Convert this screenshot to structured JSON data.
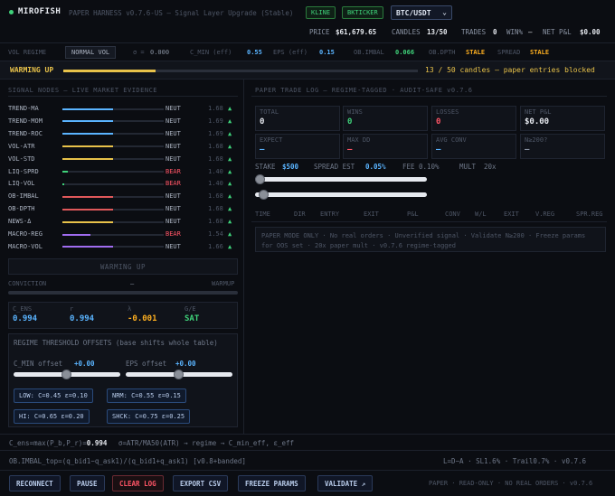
{
  "header": {
    "brand": "MIROFISH",
    "subtitle": "PAPER HARNESS v0.7.6-US — Signal Layer Upgrade (Stable)",
    "badge_kline": "KLINE",
    "badge_bkticker": "BKTICKER",
    "symbol": "BTC/USDT",
    "price_label": "PRICE",
    "price_value": "$61,679.65",
    "candles_label": "CANDLES",
    "candles_value": "13/50",
    "trades_label": "TRADES",
    "trades_value": "0",
    "wins_label": "WIN%",
    "wins_value": "—",
    "netpnl_label": "NET P&L",
    "netpnl_value": "$0.00"
  },
  "strip": {
    "vol_regime_label": "VOL REGIME",
    "vol_regime_value": "NORMAL VOL",
    "sigma_label": "σ =",
    "sigma_value": "0.000",
    "cmin_label": "C_MIN (eff)",
    "cmin_value": "0.55",
    "eps_label": "EPS (eff)",
    "eps_value": "0.15",
    "obimbal_label": "OB.IMBAL",
    "obimbal_value": "0.066",
    "obdpth_label": "OB.DPTH",
    "obdpth_value": "STALE",
    "spread_label": "SPREAD",
    "spread_value": "STALE"
  },
  "warming": {
    "label": "WARMING UP",
    "progress": 0.26,
    "status": "13 / 50 candles — paper entries blocked"
  },
  "signal_panel": {
    "title": "SIGNAL NODES — LIVE MARKET EVIDENCE",
    "nodes": [
      {
        "name": "TREND-MA",
        "fill": 0.5,
        "color": "#5ab4ff",
        "state": "NEUT",
        "value": "1.68"
      },
      {
        "name": "TREND-MOM",
        "fill": 0.5,
        "color": "#5ab4ff",
        "state": "NEUT",
        "value": "1.69"
      },
      {
        "name": "TREND-ROC",
        "fill": 0.5,
        "color": "#5ab4ff",
        "state": "NEUT",
        "value": "1.69"
      },
      {
        "name": "VOL-ATR",
        "fill": 0.5,
        "color": "#e8c24a",
        "state": "NEUT",
        "value": "1.68"
      },
      {
        "name": "VOL-STD",
        "fill": 0.5,
        "color": "#e8c24a",
        "state": "NEUT",
        "value": "1.68"
      },
      {
        "name": "LIQ-SPRD",
        "fill": 0.05,
        "color": "#3fd27a",
        "state": "BEAR",
        "value": "1.40"
      },
      {
        "name": "LIQ-VOL",
        "fill": 0.02,
        "color": "#3fd27a",
        "state": "BEAR",
        "value": "1.40"
      },
      {
        "name": "OB-IMBAL",
        "fill": 0.5,
        "color": "#e0585a",
        "state": "NEUT",
        "value": "1.68"
      },
      {
        "name": "OB-DPTH",
        "fill": 0.5,
        "color": "#e0585a",
        "state": "NEUT",
        "value": "1.68"
      },
      {
        "name": "NEWS-Δ",
        "fill": 0.5,
        "color": "#e8c24a",
        "state": "NEUT",
        "value": "1.68"
      },
      {
        "name": "MACRO-REG",
        "fill": 0.28,
        "color": "#a06cf0",
        "state": "BEAR",
        "value": "1.54"
      },
      {
        "name": "MACRO-VOL",
        "fill": 0.5,
        "color": "#a06cf0",
        "state": "NEUT",
        "value": "1.66"
      }
    ],
    "arrow": "▲",
    "warming_box": "WARMING UP",
    "conviction_label": "CONVICTION",
    "conviction_value": "—",
    "conviction_state": "WARMUP",
    "c_ens_label": "C_ENS",
    "c_ens_value": "0.994",
    "r_label": "r",
    "r_value": "0.994",
    "lambda_label": "λ",
    "lambda_value": "-0.001",
    "gate_label": "G/E",
    "gate_value": "SAT",
    "regime_title": "REGIME THRESHOLD OFFSETS (base shifts whole table)",
    "cmin_offset_label": "C_MIN offset",
    "cmin_offset_value": "+0.00",
    "eps_offset_label": "EPS offset",
    "eps_offset_value": "+0.00",
    "chips": [
      "LOW: C=0.45 ε=0.10",
      "NRM: C=0.55 ε=0.15",
      "HI: C=0.65 ε=0.20",
      "SHCK: C=0.75 ε=0.25"
    ]
  },
  "trade_panel": {
    "title": "PAPER TRADE LOG — REGIME-TAGGED · AUDIT-SAFE v0.7.6",
    "stats_row1": [
      {
        "label": "TOTAL",
        "value": "0",
        "color": "#e6e9ef"
      },
      {
        "label": "WINS",
        "value": "0",
        "color": "#3fd27a"
      },
      {
        "label": "LOSSES",
        "value": "0",
        "color": "#ff5566"
      },
      {
        "label": "NET P&L",
        "value": "$0.00",
        "color": "#e6e9ef"
      }
    ],
    "stats_row2": [
      {
        "label": "EXPECT",
        "value": "—",
        "color": "#5ab4ff"
      },
      {
        "label": "MAX DD",
        "value": "—",
        "color": "#ff5566"
      },
      {
        "label": "AVG CONV",
        "value": "—",
        "color": "#5ab4ff"
      },
      {
        "label": "N≥200?",
        "value": "—",
        "color": "#8a93a3"
      }
    ],
    "stake_label": "STAKE",
    "stake_value": "$500",
    "spread_label": "SPREAD EST",
    "spread_value": "0.05%",
    "fee_label": "FEE",
    "fee_value": "0.10%",
    "mult_label": "MULT",
    "mult_value": "20x",
    "columns": [
      "TIME",
      "DIR",
      "ENTRY",
      "EXIT",
      "P&L",
      "CONV",
      "W/L",
      "EXIT",
      "V.REG",
      "SPR.REG"
    ],
    "notice": "PAPER MODE ONLY · No real orders · Unverified signal · Validate N≥200 · Freeze params for OOS set · 20x paper mult · v0.7.6 regime-tagged"
  },
  "formula": {
    "line1_a": "C_ens=max(P_b,P_r)=",
    "line1_val": "0.994",
    "line1_b": "σ=ATR/MA50(ATR) → regime → C_min_eff, ε_eff",
    "line2": "OB.IMBAL_top=(q_bid1−q_ask1)/(q_bid1+q_ask1) [v0.8+banded]",
    "line2_right": "L=D−A · SL1.6% · Trail0.7% · v0.7.6"
  },
  "footer": {
    "reconnect": "RECONNECT",
    "pause": "PAUSE",
    "clear_log": "CLEAR LOG",
    "export_csv": "EXPORT CSV",
    "freeze_params": "FREEZE PARAMS",
    "validate": "VALIDATE ↗",
    "status": "PAPER · READ-ONLY · NO REAL ORDERS · v0.7.6"
  },
  "colors": {
    "accent": "#5ab4ff",
    "win": "#3fd27a",
    "loss": "#ff5566",
    "warning": "#e8c24a"
  }
}
